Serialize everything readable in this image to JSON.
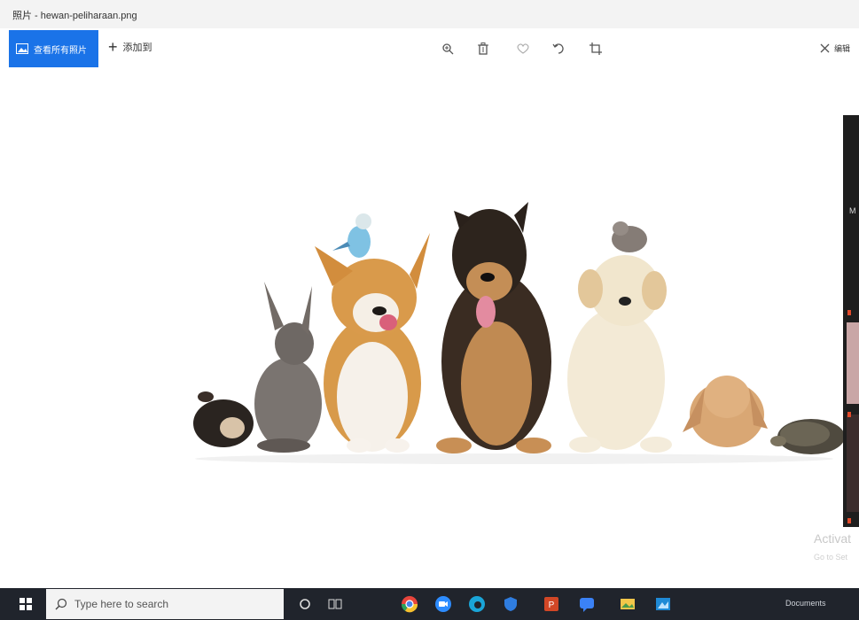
{
  "window": {
    "title": "照片 - hewan-peliharaan.png"
  },
  "toolbar": {
    "view_all_label": "查看所有照片",
    "add_to_label": "添加到",
    "edit_label": "编辑"
  },
  "tools": [
    "zoom-icon",
    "delete-icon",
    "favorite-icon",
    "rotate-icon",
    "crop-icon"
  ],
  "watermark": {
    "line1": "Activat",
    "line2": "Go to Set"
  },
  "side_panel": {
    "letter": "M"
  },
  "taskbar": {
    "search_placeholder": "Type here to search",
    "apps": [
      "cortana-icon",
      "task-view-icon",
      "chrome-icon",
      "zoom-app-icon",
      "edge-icon",
      "security-icon",
      "powerpoint-icon",
      "chat-icon",
      "photos-icon",
      "gallery-icon"
    ],
    "tray_text": "Documents"
  },
  "colors": {
    "accent": "#1a73e8",
    "taskbar": "#20242c",
    "titlebar": "#f3f3f3"
  }
}
